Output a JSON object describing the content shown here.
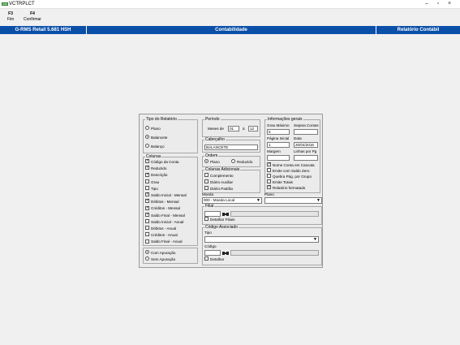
{
  "window": {
    "title": "VCTRPLCT"
  },
  "toolbar": {
    "f3": {
      "key": "F3",
      "label": "Fim"
    },
    "f4": {
      "key": "F4",
      "label": "Confirmar"
    }
  },
  "header": {
    "left": "G-RMS Retail 5.681 HSH",
    "center": "Contabilidade",
    "right": "Relatório Contábil"
  },
  "tipo_relatorio": {
    "title": "Tipo do Relatório",
    "options": [
      "Plano",
      "Balancete",
      "Balanço"
    ],
    "selected": "Balancete"
  },
  "colunas": {
    "title": "Colunas",
    "items": [
      {
        "label": "Código da Conta",
        "checked": true
      },
      {
        "label": "Reduzido",
        "checked": true
      },
      {
        "label": "Descrição",
        "checked": true
      },
      {
        "label": "Grau",
        "checked": false
      },
      {
        "label": "Tipo",
        "checked": false
      },
      {
        "label": "Saldo Inicial - Mensal",
        "checked": true
      },
      {
        "label": "Débitos - Mensal",
        "checked": true
      },
      {
        "label": "Créditos - Mensal",
        "checked": true
      },
      {
        "label": "Saldo Final - Mensal",
        "checked": true
      },
      {
        "label": "Saldo Inicial - Anual",
        "checked": false
      },
      {
        "label": "Débitos - Anual",
        "checked": false
      },
      {
        "label": "Créditos - Anual",
        "checked": false
      },
      {
        "label": "Saldo Final - Anual",
        "checked": false
      }
    ]
  },
  "apuracao": {
    "options": [
      "Com Apuração",
      "Sem Apuração"
    ],
    "selected": "Com Apuração"
  },
  "periodo": {
    "title": "Período",
    "meses_label": "Meses de",
    "from": "01",
    "to_label": "à",
    "to": "12"
  },
  "cabecalho": {
    "title": "Cabeçalho",
    "value": "BALANCETE"
  },
  "ordem": {
    "title": "Ordem",
    "options": [
      "Plano",
      "Reduzido"
    ],
    "selected": "Plano"
  },
  "colunas_adicionais": {
    "title": "Colunas Adicionais",
    "items": [
      {
        "label": "Complemento",
        "checked": false
      },
      {
        "label": "Diário Auxiliar",
        "checked": false
      },
      {
        "label": "Diário Padrão",
        "checked": false
      }
    ]
  },
  "info": {
    "title": "Informações gerais",
    "grau_label": "Grau Máximo",
    "grau_value": "5",
    "separa_label": "Separa Contas",
    "separa_value": "",
    "pagina_label": "Página Inicial",
    "pagina_value": "1",
    "data_label": "Data",
    "data_value": "20/04/2016",
    "margem_label": "Margem",
    "margem_value": "",
    "linhas_label": "Linhas por Pg",
    "linhas_value": "",
    "checks": [
      {
        "label": "Nome Conta em Cascata",
        "checked": true
      },
      {
        "label": "Emite com Saldo Zero",
        "checked": false
      },
      {
        "label": "Quebra Pág. por Grupo",
        "checked": false
      },
      {
        "label": "Emite Totais",
        "checked": false
      },
      {
        "label": "Relatório formatado",
        "checked": true
      }
    ]
  },
  "moeda": {
    "label": "Moeda",
    "value": "000 - Moeda Local"
  },
  "plano": {
    "label": "Plano",
    "value": ""
  },
  "filial": {
    "title": "Filial",
    "code": "",
    "desc": "",
    "detalhar_label": "Detalhar Filiais",
    "detalhar": false
  },
  "codigo_associado": {
    "title": "Código Associado",
    "tipo_label": "Tipo",
    "tipo_value": "",
    "codigo_label": "Código",
    "codigo_value": "",
    "desc": "",
    "detalhar_label": "Detalhar",
    "detalhar": false
  },
  "icons": {
    "check": "✓",
    "binoculars": "binoculars-icon",
    "dropdown": "▼"
  },
  "colors": {
    "header_bg": "#0a4fa8",
    "panel_bg": "#ebebeb"
  }
}
